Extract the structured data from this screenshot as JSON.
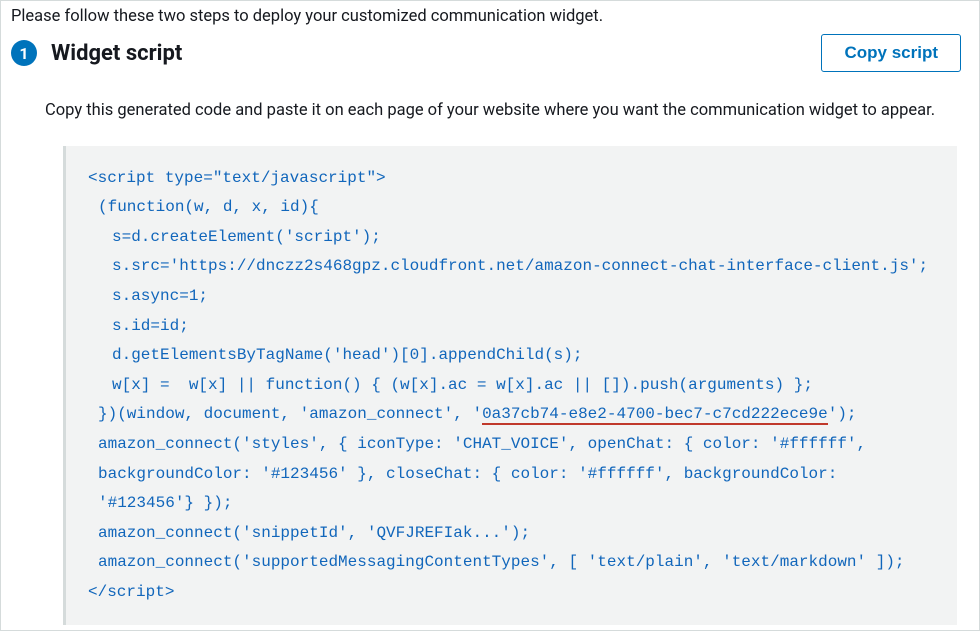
{
  "intro": "Please follow these two steps to deploy your customized communication widget.",
  "step_number": "1",
  "title": "Widget script",
  "copy_button_label": "Copy script",
  "description": "Copy this generated code and paste it on each page of your website where you want the communication widget to appear.",
  "code": {
    "l1": "<script type=\"text/javascript\">",
    "l2": "(function(w, d, x, id){",
    "l3": "s=d.createElement('script');",
    "l4": "s.src='https://dnczz2s468gpz.cloudfront.net/amazon-connect-chat-interface-client.js';",
    "l5": "s.async=1;",
    "l6": "s.id=id;",
    "l7": "d.getElementsByTagName('head')[0].appendChild(s);",
    "l8": "w[x] =  w[x] || function() { (w[x].ac = w[x].ac || []).push(arguments) };",
    "l9a": "})(window, document, 'amazon_connect', '",
    "l9_uuid": "0a37cb74-e8e2-4700-bec7-c7cd222ece9e",
    "l9b": "');",
    "l10": "amazon_connect('styles', { iconType: 'CHAT_VOICE', openChat: { color: '#ffffff', backgroundColor: '#123456' }, closeChat: { color: '#ffffff', backgroundColor: '#123456'} });",
    "l11": "amazon_connect('snippetId', 'QVFJREFIak...');",
    "l12": "amazon_connect('supportedMessagingContentTypes', [ 'text/plain', 'text/markdown' ]);",
    "l13": "</script>"
  }
}
